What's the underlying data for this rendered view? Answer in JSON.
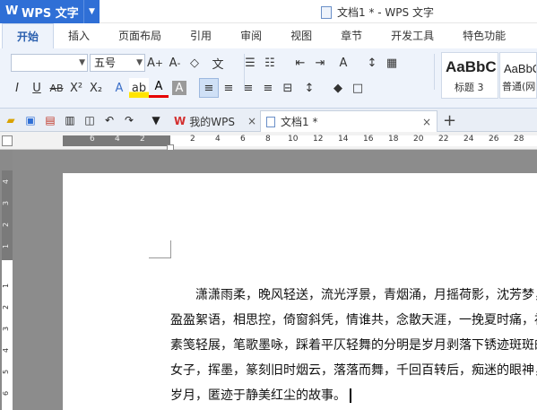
{
  "app": {
    "name": "WPS 文字",
    "logo": "W",
    "window_title": "文档1 * - WPS 文字"
  },
  "ribbon_tabs": [
    "开始",
    "插入",
    "页面布局",
    "引用",
    "审阅",
    "视图",
    "章节",
    "开发工具",
    "特色功能"
  ],
  "toolbar": {
    "font_size": "五号",
    "styles": [
      {
        "sample": "AaBbC",
        "label": "标题 3"
      },
      {
        "sample": "AaBbC",
        "label": "普通(网"
      }
    ]
  },
  "doc_tabs": [
    {
      "label": "我的WPS",
      "close": "×"
    },
    {
      "label": "文档1 *",
      "close": "×"
    }
  ],
  "ruler": {
    "h_numbers": [
      "6",
      "4",
      "2",
      "2",
      "4",
      "6",
      "8",
      "10",
      "12",
      "14",
      "16",
      "18",
      "20",
      "22",
      "24",
      "26",
      "28"
    ],
    "v_numbers": [
      "4",
      "3",
      "2",
      "1",
      "1",
      "2",
      "3",
      "4",
      "5",
      "6"
    ]
  },
  "document": {
    "lines": [
      "潇潇雨柔，晚风轻送，流光浮景，青烟涌，月摇荷影，沈芳梦，",
      "盈盈絮语，相思控，倚窗斜凭，情谁共，念散天涯，一挽夏时痛，衫",
      "素笺轻展，笔歌墨咏，踩着平仄轻舞的分明是岁月剥落下锈迹斑斑的",
      "女子，挥墨，篆刻旧时烟云，落落而舞，千回百转后，痴迷的眼神，",
      "岁月，匿迹于静美红尘的故事。"
    ]
  },
  "colors": {
    "accent": "#2f6fd6",
    "ribbon_bg": "#eef3fb"
  }
}
